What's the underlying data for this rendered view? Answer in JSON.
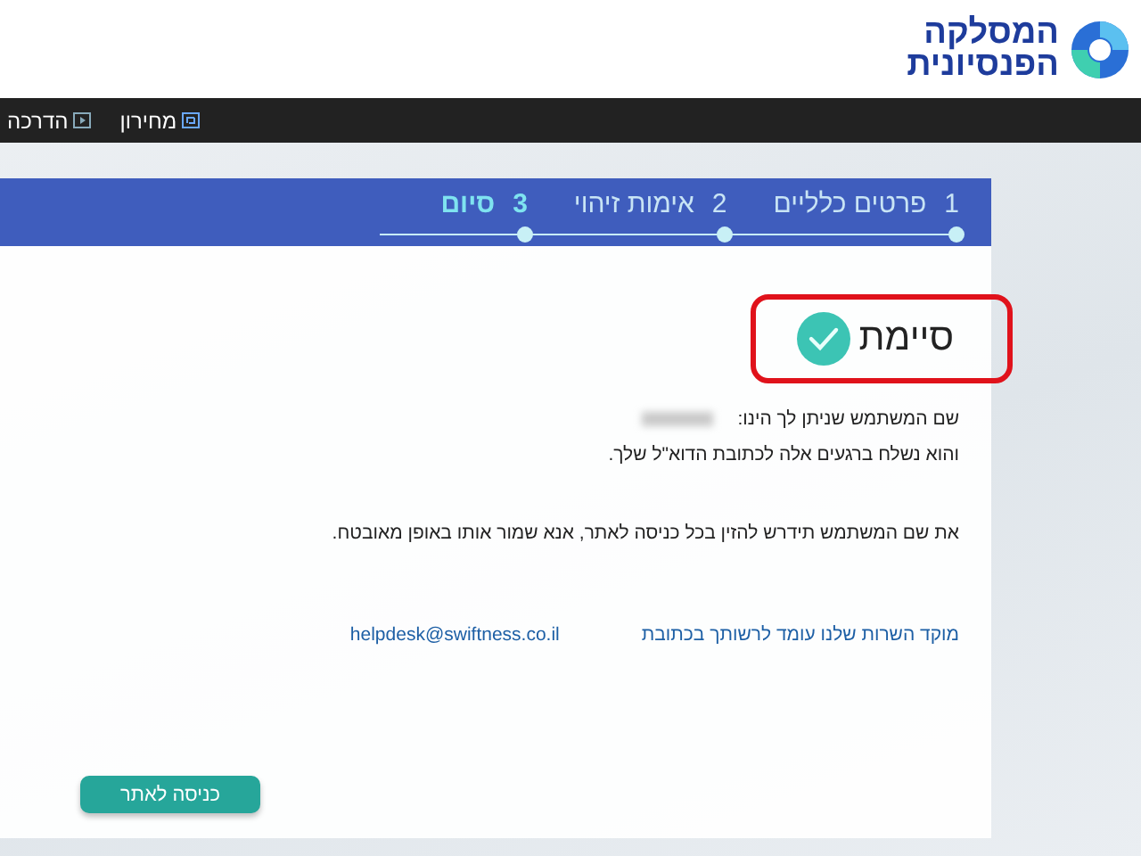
{
  "logo": {
    "line_1": "המסלקה",
    "line_2": "הפנסיונית"
  },
  "nav": [
    {
      "kind": "pricing",
      "label": "מחירון"
    },
    {
      "kind": "guide",
      "label": "הדרכה"
    }
  ],
  "steps": [
    {
      "number": "1",
      "label": "פרטים כלליים",
      "selected": false
    },
    {
      "number": "2",
      "label": "אימות זיהוי",
      "selected": false
    },
    {
      "number": "3",
      "label": "סיום",
      "selected": true
    }
  ],
  "completion": {
    "title": "סיימת",
    "highlighted": true
  },
  "username_label": "שם המשתמש שניתן לך הינו:",
  "messages": [
    "והוא נשלח ברגעים אלה לכתובת הדוא\"ל שלך.",
    "את שם המשתמש תידרש להזין בכל כניסה לאתר, אנא שמור אותו באופן מאובטח."
  ],
  "contact": {
    "text": "מוקד השרות שלנו עומד לרשותך בכתובת",
    "email": "helpdesk@swiftness.co.il"
  },
  "enter_button": "כניסה לאתר"
}
